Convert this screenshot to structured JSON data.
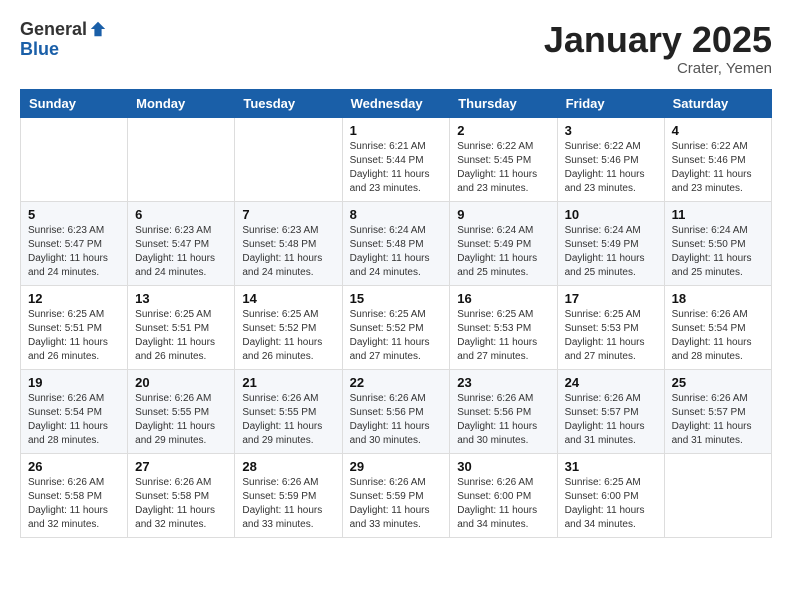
{
  "logo": {
    "general": "General",
    "blue": "Blue"
  },
  "title": "January 2025",
  "location": "Crater, Yemen",
  "headers": [
    "Sunday",
    "Monday",
    "Tuesday",
    "Wednesday",
    "Thursday",
    "Friday",
    "Saturday"
  ],
  "weeks": [
    [
      {
        "day": "",
        "info": ""
      },
      {
        "day": "",
        "info": ""
      },
      {
        "day": "",
        "info": ""
      },
      {
        "day": "1",
        "info": "Sunrise: 6:21 AM\nSunset: 5:44 PM\nDaylight: 11 hours\nand 23 minutes."
      },
      {
        "day": "2",
        "info": "Sunrise: 6:22 AM\nSunset: 5:45 PM\nDaylight: 11 hours\nand 23 minutes."
      },
      {
        "day": "3",
        "info": "Sunrise: 6:22 AM\nSunset: 5:46 PM\nDaylight: 11 hours\nand 23 minutes."
      },
      {
        "day": "4",
        "info": "Sunrise: 6:22 AM\nSunset: 5:46 PM\nDaylight: 11 hours\nand 23 minutes."
      }
    ],
    [
      {
        "day": "5",
        "info": "Sunrise: 6:23 AM\nSunset: 5:47 PM\nDaylight: 11 hours\nand 24 minutes."
      },
      {
        "day": "6",
        "info": "Sunrise: 6:23 AM\nSunset: 5:47 PM\nDaylight: 11 hours\nand 24 minutes."
      },
      {
        "day": "7",
        "info": "Sunrise: 6:23 AM\nSunset: 5:48 PM\nDaylight: 11 hours\nand 24 minutes."
      },
      {
        "day": "8",
        "info": "Sunrise: 6:24 AM\nSunset: 5:48 PM\nDaylight: 11 hours\nand 24 minutes."
      },
      {
        "day": "9",
        "info": "Sunrise: 6:24 AM\nSunset: 5:49 PM\nDaylight: 11 hours\nand 25 minutes."
      },
      {
        "day": "10",
        "info": "Sunrise: 6:24 AM\nSunset: 5:49 PM\nDaylight: 11 hours\nand 25 minutes."
      },
      {
        "day": "11",
        "info": "Sunrise: 6:24 AM\nSunset: 5:50 PM\nDaylight: 11 hours\nand 25 minutes."
      }
    ],
    [
      {
        "day": "12",
        "info": "Sunrise: 6:25 AM\nSunset: 5:51 PM\nDaylight: 11 hours\nand 26 minutes."
      },
      {
        "day": "13",
        "info": "Sunrise: 6:25 AM\nSunset: 5:51 PM\nDaylight: 11 hours\nand 26 minutes."
      },
      {
        "day": "14",
        "info": "Sunrise: 6:25 AM\nSunset: 5:52 PM\nDaylight: 11 hours\nand 26 minutes."
      },
      {
        "day": "15",
        "info": "Sunrise: 6:25 AM\nSunset: 5:52 PM\nDaylight: 11 hours\nand 27 minutes."
      },
      {
        "day": "16",
        "info": "Sunrise: 6:25 AM\nSunset: 5:53 PM\nDaylight: 11 hours\nand 27 minutes."
      },
      {
        "day": "17",
        "info": "Sunrise: 6:25 AM\nSunset: 5:53 PM\nDaylight: 11 hours\nand 27 minutes."
      },
      {
        "day": "18",
        "info": "Sunrise: 6:26 AM\nSunset: 5:54 PM\nDaylight: 11 hours\nand 28 minutes."
      }
    ],
    [
      {
        "day": "19",
        "info": "Sunrise: 6:26 AM\nSunset: 5:54 PM\nDaylight: 11 hours\nand 28 minutes."
      },
      {
        "day": "20",
        "info": "Sunrise: 6:26 AM\nSunset: 5:55 PM\nDaylight: 11 hours\nand 29 minutes."
      },
      {
        "day": "21",
        "info": "Sunrise: 6:26 AM\nSunset: 5:55 PM\nDaylight: 11 hours\nand 29 minutes."
      },
      {
        "day": "22",
        "info": "Sunrise: 6:26 AM\nSunset: 5:56 PM\nDaylight: 11 hours\nand 30 minutes."
      },
      {
        "day": "23",
        "info": "Sunrise: 6:26 AM\nSunset: 5:56 PM\nDaylight: 11 hours\nand 30 minutes."
      },
      {
        "day": "24",
        "info": "Sunrise: 6:26 AM\nSunset: 5:57 PM\nDaylight: 11 hours\nand 31 minutes."
      },
      {
        "day": "25",
        "info": "Sunrise: 6:26 AM\nSunset: 5:57 PM\nDaylight: 11 hours\nand 31 minutes."
      }
    ],
    [
      {
        "day": "26",
        "info": "Sunrise: 6:26 AM\nSunset: 5:58 PM\nDaylight: 11 hours\nand 32 minutes."
      },
      {
        "day": "27",
        "info": "Sunrise: 6:26 AM\nSunset: 5:58 PM\nDaylight: 11 hours\nand 32 minutes."
      },
      {
        "day": "28",
        "info": "Sunrise: 6:26 AM\nSunset: 5:59 PM\nDaylight: 11 hours\nand 33 minutes."
      },
      {
        "day": "29",
        "info": "Sunrise: 6:26 AM\nSunset: 5:59 PM\nDaylight: 11 hours\nand 33 minutes."
      },
      {
        "day": "30",
        "info": "Sunrise: 6:26 AM\nSunset: 6:00 PM\nDaylight: 11 hours\nand 34 minutes."
      },
      {
        "day": "31",
        "info": "Sunrise: 6:25 AM\nSunset: 6:00 PM\nDaylight: 11 hours\nand 34 minutes."
      },
      {
        "day": "",
        "info": ""
      }
    ]
  ]
}
